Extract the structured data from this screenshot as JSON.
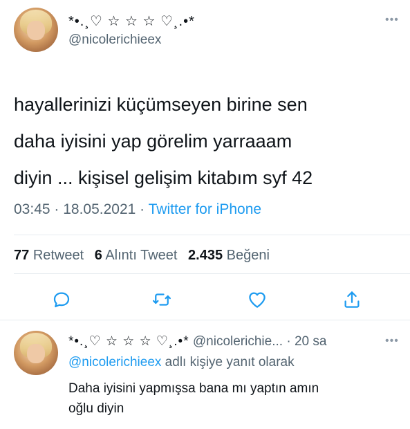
{
  "tweet": {
    "display_name": "*•.¸♡ ☆ ☆ ☆ ♡¸.•*",
    "handle": "@nicolerichieex",
    "text_lines": [
      "hayallerinizi küçümseyen birine sen",
      "daha iyisini yap görelim yarraaam",
      "diyin ... kişisel gelişim kitabım syf 42"
    ],
    "time": "03:45",
    "separator_1": " · ",
    "date": "18.05.2021",
    "separator_2": " · ",
    "client": "Twitter for iPhone",
    "stats": {
      "retweet_count": "77",
      "retweet_label": "Retweet",
      "quote_count": "6",
      "quote_label": "Alıntı Tweet",
      "like_count": "2.435",
      "like_label": "Beğeni"
    },
    "more_icon": "ellipsis-icon",
    "action_icons": [
      "reply-icon",
      "retweet-icon",
      "like-icon",
      "share-icon"
    ]
  },
  "reply": {
    "display_name": "*•.¸♡ ☆ ☆ ☆ ♡¸.•*",
    "handle": "@nicolerichie...",
    "separator": " · ",
    "time_ago": "20 sa",
    "reply_to_handle": "@nicolerichieex",
    "reply_to_suffix": " adlı kişiye yanıt olarak",
    "text_lines": [
      "Daha iyisini yapmışsa bana mı yaptın amın",
      "oğlu diyin"
    ]
  },
  "colors": {
    "text": "#0f1419",
    "secondary": "#536471",
    "accent": "#1d9bf0",
    "divider": "#e6ecf0"
  }
}
